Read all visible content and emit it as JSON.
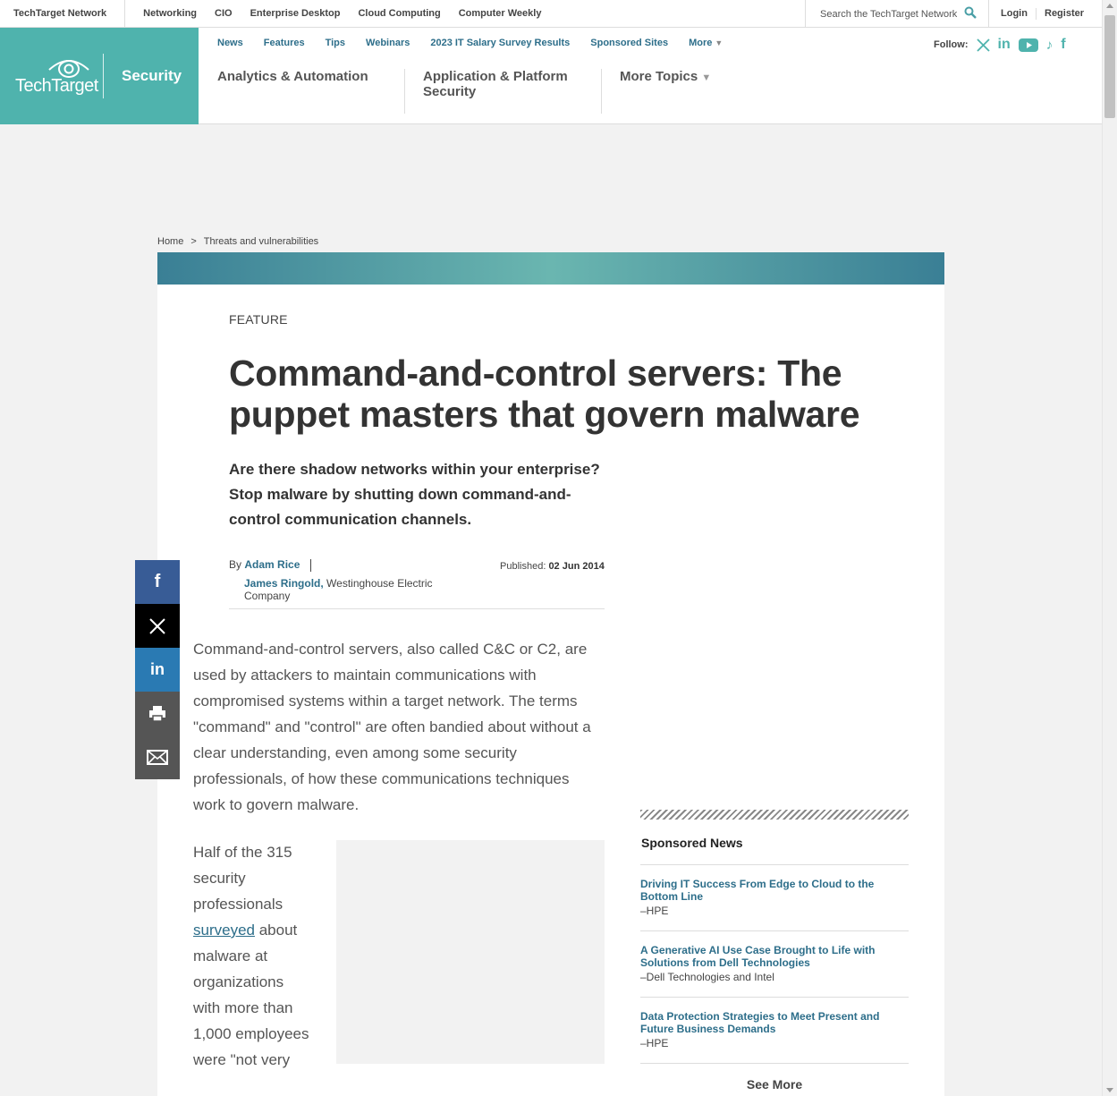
{
  "netbar": {
    "brand": "TechTarget Network",
    "links": [
      "Networking",
      "CIO",
      "Enterprise Desktop",
      "Cloud Computing",
      "Computer Weekly"
    ],
    "search_placeholder": "Search the TechTarget Network",
    "login": "Login",
    "register": "Register"
  },
  "header": {
    "logo_text": "TechTarget",
    "section": "Security",
    "subnav": [
      "News",
      "Features",
      "Tips",
      "Webinars",
      "2023 IT Salary Survey Results",
      "Sponsored Sites"
    ],
    "more": "More",
    "follow_label": "Follow:",
    "topics": [
      "Analytics & Automation",
      "Application & Platform Security",
      "More Topics"
    ]
  },
  "breadcrumb": {
    "home": "Home",
    "sep": ">",
    "current": "Threats and vulnerabilities"
  },
  "article": {
    "kicker": "FEATURE",
    "title": "Command-and-control servers: The puppet masters that govern malware",
    "dek": "Are there shadow networks within your enterprise? Stop malware by shutting down command-and-control communication channels.",
    "by": "By",
    "author1": "Adam Rice",
    "author2": "James Ringold,",
    "author2_company": "Westinghouse Electric Company",
    "published_label": "Published:",
    "published_date": "02 Jun 2014",
    "para1": "Command-and-control servers, also called C&C or C2, are used by attackers to maintain communications with compromised systems within a target network. The terms \"command\" and \"control\" are often bandied about without a clear understanding, even among some security professionals, of how these communications techniques work to govern malware.",
    "para2_pre": "Half of the 315 security professionals",
    "para2_link": "surveyed",
    "para2_post": "about malware at organizations with more than 1,000 employees were \"not very"
  },
  "share": [
    "facebook-icon",
    "x-icon",
    "linkedin-icon",
    "print-icon",
    "email-icon"
  ],
  "sponsored": {
    "title": "Sponsored News",
    "items": [
      {
        "headline": "Driving IT Success From Edge to Cloud to the Bottom Line",
        "source": "–HPE"
      },
      {
        "headline": "A Generative AI Use Case Brought to Life with Solutions from Dell Technologies",
        "source": "–Dell Technologies and Intel"
      },
      {
        "headline": "Data Protection Strategies to Meet Present and Future Business Demands",
        "source": "–HPE"
      }
    ],
    "see_more": "See More"
  }
}
